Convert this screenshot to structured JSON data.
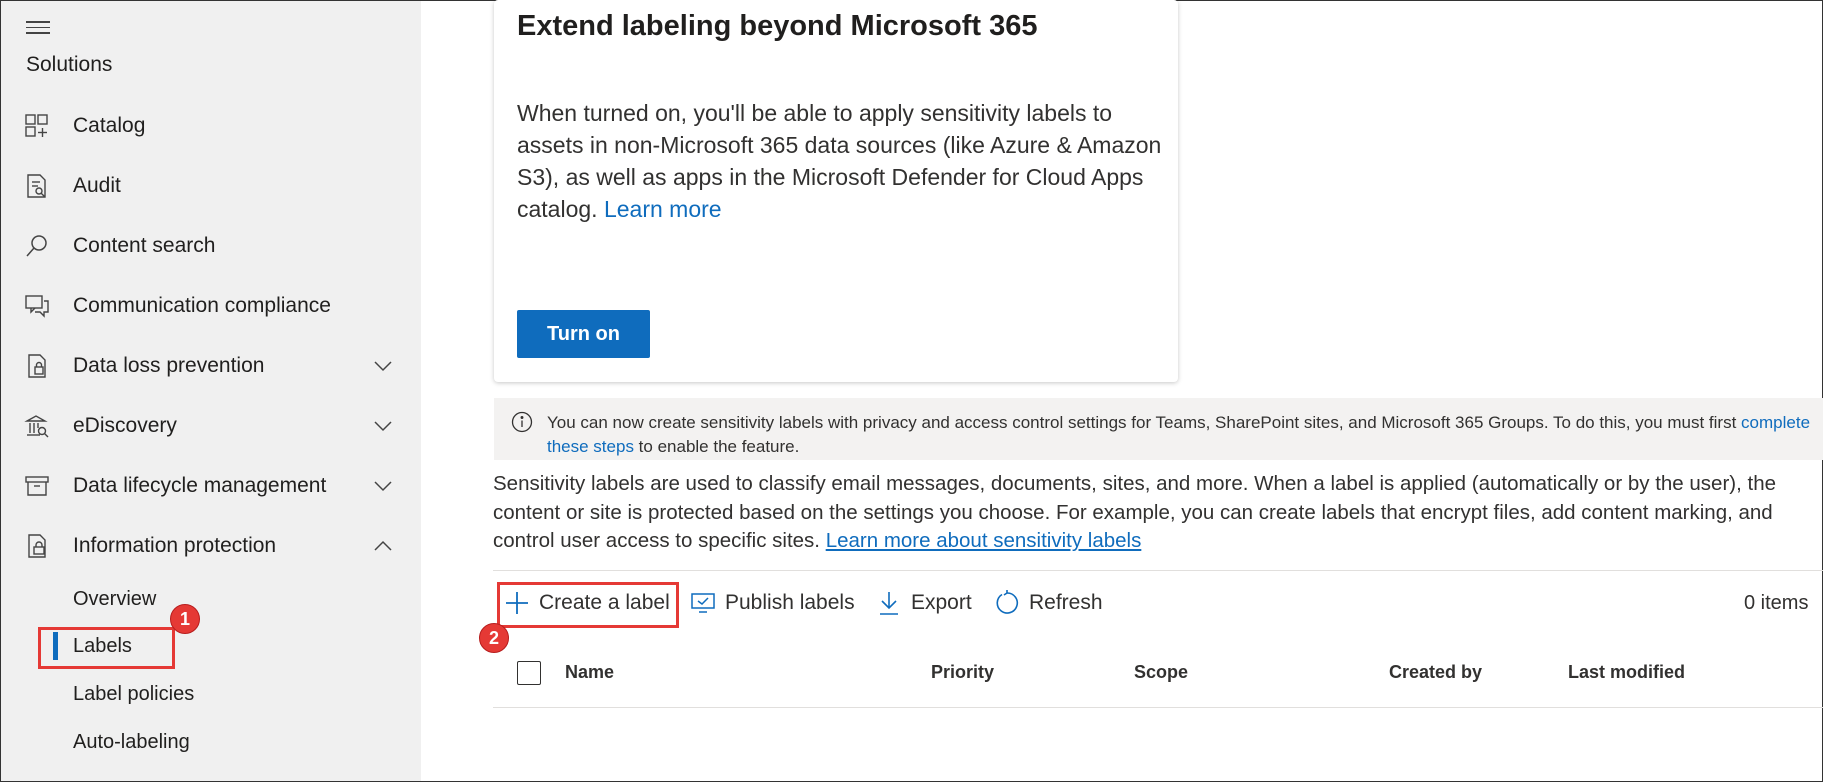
{
  "sidebar": {
    "heading": "Solutions",
    "items": [
      {
        "label": "Catalog",
        "icon": "catalog-icon"
      },
      {
        "label": "Audit",
        "icon": "audit-icon"
      },
      {
        "label": "Content search",
        "icon": "search-icon"
      },
      {
        "label": "Communication compliance",
        "icon": "chat-icon"
      },
      {
        "label": "Data loss prevention",
        "icon": "dlp-icon",
        "expandable": true
      },
      {
        "label": "eDiscovery",
        "icon": "ediscovery-icon",
        "expandable": true
      },
      {
        "label": "Data lifecycle management",
        "icon": "archive-icon",
        "expandable": true
      },
      {
        "label": "Information protection",
        "icon": "info-protection-icon",
        "expanded": true
      }
    ],
    "sub_items": [
      "Overview",
      "Labels",
      "Label policies",
      "Auto-labeling"
    ],
    "selected_sub_item": "Labels"
  },
  "card": {
    "title": "Extend labeling beyond Microsoft 365",
    "body": "When turned on, you'll be able to apply sensitivity labels to assets in non-Microsoft 365 data sources (like Azure & Amazon S3), as well as apps in the Microsoft Defender for Cloud Apps catalog. ",
    "link": "Learn more",
    "button": "Turn on"
  },
  "info_bar": {
    "text_before": "You can now create sensitivity labels with privacy and access control settings for Teams, SharePoint sites, and Microsoft 365 Groups. To do this, you must first ",
    "link": "complete these steps",
    "text_after": " to enable the feature."
  },
  "description": {
    "text": "Sensitivity labels are used to classify email messages, documents, sites, and more. When a label is applied (automatically or by the user), the content or site is protected based on the settings you choose. For example, you can create labels that encrypt files, add content marking, and control user access to specific sites. ",
    "link": "Learn more about sensitivity labels"
  },
  "toolbar": {
    "create": "Create a label",
    "publish": "Publish labels",
    "export": "Export",
    "refresh": "Refresh",
    "items_count": "0 items"
  },
  "table": {
    "columns": [
      "Name",
      "Priority",
      "Scope",
      "Created by",
      "Last modified"
    ]
  },
  "annotations": {
    "badge1": "1",
    "badge2": "2"
  },
  "colors": {
    "accent": "#0f6cbd",
    "highlight": "#e53935",
    "sidebar_bg": "#f0f0f0"
  }
}
